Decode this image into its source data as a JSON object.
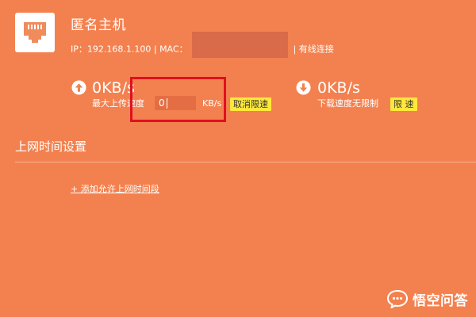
{
  "device": {
    "name": "匿名主机",
    "ip_label": "IP：192.168.1.100",
    "mac_label": "MAC：",
    "connection": "| 有线连接",
    "icon": "ethernet-port-icon"
  },
  "upload": {
    "speed": "0KB/s",
    "label": "最大上传速度",
    "limit_value": "0",
    "unit": "KB/s",
    "action": "取消限速",
    "icon": "upload-arrow-icon"
  },
  "download": {
    "speed": "0KB/s",
    "label": "下载速度无限制",
    "action": "限 速",
    "icon": "download-arrow-icon"
  },
  "schedule": {
    "title": "上网时间设置",
    "add_link": "+ 添加允许上网时间段"
  },
  "watermark": {
    "text": "悟空问答"
  },
  "colors": {
    "background": "#f3814f",
    "button": "#ffe83b",
    "highlight": "#e0101e"
  }
}
